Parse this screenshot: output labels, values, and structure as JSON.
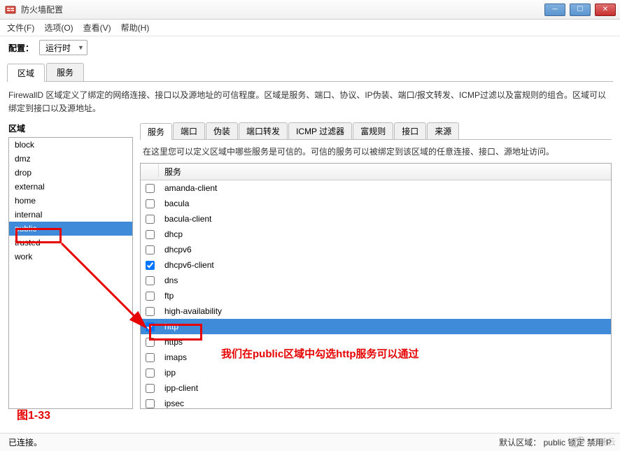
{
  "window": {
    "title": "防火墙配置"
  },
  "menu": {
    "file": "文件(F)",
    "options": "选项(O)",
    "view": "查看(V)",
    "help": "帮助(H)"
  },
  "config": {
    "label": "配置：",
    "value": "运行时"
  },
  "outer_tabs": {
    "zones": "区域",
    "services": "服务"
  },
  "description": "FirewallD 区域定义了绑定的网络连接、接口以及源地址的可信程度。区域是服务、端口、协议、IP伪装、端口/报文转发、ICMP过滤以及富规则的组合。区域可以绑定到接口以及源地址。",
  "left": {
    "title": "区域",
    "items": [
      "block",
      "dmz",
      "drop",
      "external",
      "home",
      "internal",
      "public",
      "trusted",
      "work"
    ],
    "selected": "public"
  },
  "inner_tabs": [
    "服务",
    "端口",
    "伪装",
    "端口转发",
    "ICMP 过滤器",
    "富规则",
    "接口",
    "来源"
  ],
  "inner_active": "服务",
  "inner_desc": "在这里您可以定义区域中哪些服务是可信的。可信的服务可以被绑定到该区域的任意连接、接口、源地址访问。",
  "svc_header": "服务",
  "services": [
    {
      "name": "amanda-client",
      "checked": false
    },
    {
      "name": "bacula",
      "checked": false
    },
    {
      "name": "bacula-client",
      "checked": false
    },
    {
      "name": "dhcp",
      "checked": false
    },
    {
      "name": "dhcpv6",
      "checked": false
    },
    {
      "name": "dhcpv6-client",
      "checked": true
    },
    {
      "name": "dns",
      "checked": false
    },
    {
      "name": "ftp",
      "checked": false
    },
    {
      "name": "high-availability",
      "checked": false
    },
    {
      "name": "http",
      "checked": true,
      "selected": true
    },
    {
      "name": "https",
      "checked": false
    },
    {
      "name": "imaps",
      "checked": false
    },
    {
      "name": "ipp",
      "checked": false
    },
    {
      "name": "ipp-client",
      "checked": false
    },
    {
      "name": "ipsec",
      "checked": false
    }
  ],
  "status": {
    "left": "已连接。",
    "right": "默认区域： public 锁定 禁用 P"
  },
  "annotation": {
    "fig": "图1-33",
    "note": "我们在public区域中勾选http服务可以通过"
  },
  "watermark": "亿速云"
}
